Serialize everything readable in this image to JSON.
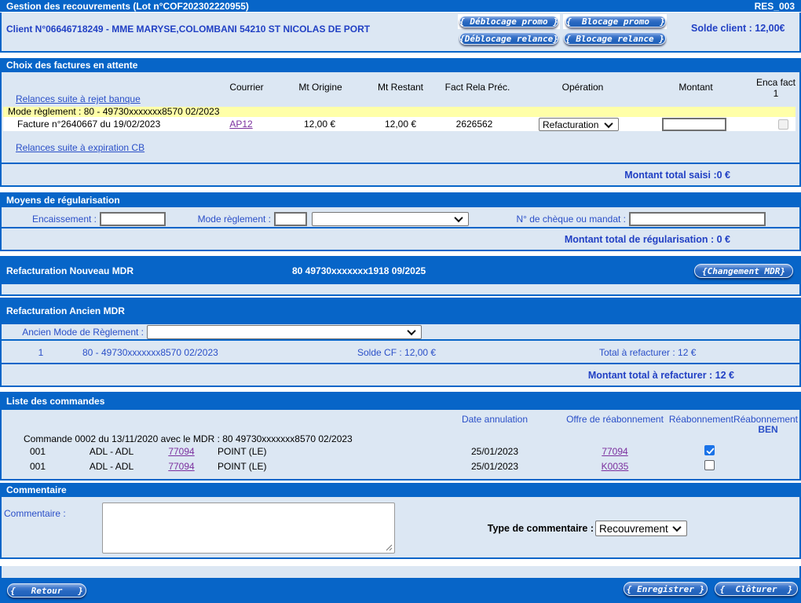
{
  "title_bar": {
    "title": "Gestion des recouvrements (Lot n°COF202302220955)",
    "code": "RES_003"
  },
  "client": {
    "info": "Client N°06646718249 - MME MARYSE,COLOMBANI 54210 ST NICOLAS DE PORT",
    "solde": "Solde client : 12,00€",
    "buttons": {
      "deblocage_promo": "{ Déblocage promo }",
      "blocage_promo": "{  Blocage promo  }",
      "deblocage_relance": "{Déblocage relance}",
      "blocage_relance": "{ Blocage relance }"
    }
  },
  "factures": {
    "section_title": "Choix des factures en attente",
    "columns": {
      "courrier": "Courrier",
      "mt_origine": "Mt Origine",
      "mt_restant": "Mt Restant",
      "fact_rela": "Fact Rela Préc.",
      "operation": "Opération",
      "montant": "Montant",
      "enca_fact_line1": "Enca fact",
      "enca_fact_line2": "1"
    },
    "link_rejet": "Relances suite à rejet banque",
    "mode_reglement": "Mode règlement : 80 - 49730xxxxxxx8570 02/2023",
    "row": {
      "label": "Facture n°2640667 du 19/02/2023",
      "courrier": "AP12",
      "mt_origine": "12,00 €",
      "mt_restant": "12,00 €",
      "fact_rela": "2626562",
      "operation_value": "Refacturation",
      "montant_value": ""
    },
    "link_expiration": "Relances suite à expiration CB",
    "total": "Montant total saisi :0 €"
  },
  "moyens": {
    "section_title": "Moyens de régularisation",
    "encaissement_label": "Encaissement :",
    "encaissement_value": "",
    "mode_reglement_label": "Mode règlement :",
    "mode_reglement_value": "",
    "mode_reglement_select": "",
    "cheque_label": "N° de chèque ou mandat :",
    "cheque_value": "",
    "total": "Montant total de régularisation : 0 €"
  },
  "nouveau_mdr": {
    "section_title": "Refacturation Nouveau MDR",
    "mdr": "80 49730xxxxxxx1918 09/2025",
    "button": "{Changement MDR}"
  },
  "ancien_mdr": {
    "section_title": "Refacturation Ancien MDR",
    "select_label": "Ancien Mode de Règlement :",
    "select_value": "",
    "row": {
      "num": "1",
      "mdr": "80 - 49730xxxxxxx8570 02/2023",
      "solde": "Solde CF : 12,00 €",
      "total": "Total à refacturer : 12 €"
    },
    "total": "Montant total à refacturer : 12 €"
  },
  "commandes": {
    "section_title": "Liste des commandes",
    "columns": {
      "date_annulation": "Date annulation",
      "offre": "Offre de réabonnement",
      "reabonnement": "Réabonnement",
      "reabonnement_ben_line1": "Réabonnement",
      "reabonnement_ben_line2": "BEN"
    },
    "commande_label": "Commande 0002 du 13/11/2020 avec le MDR : 80 49730xxxxxxx8570 02/2023",
    "rows": [
      {
        "num": "001",
        "type": "ADL - ADL",
        "code": "77094",
        "nom": "POINT (LE)",
        "date": "25/01/2023",
        "offre": "77094",
        "checked": true
      },
      {
        "num": "001",
        "type": "ADL - ADL",
        "code": "77094",
        "nom": "POINT (LE)",
        "date": "25/01/2023",
        "offre": "K0035",
        "checked": false
      }
    ]
  },
  "commentaire": {
    "section_title": "Commentaire",
    "label": "Commentaire :",
    "value": "",
    "type_label": "Type de commentaire :",
    "type_value": "Recouvrement"
  },
  "footer": {
    "retour": "{   Retour   }",
    "enregistrer": "{ Enregistrer }",
    "cloturer": "{  Clôturer  }"
  }
}
